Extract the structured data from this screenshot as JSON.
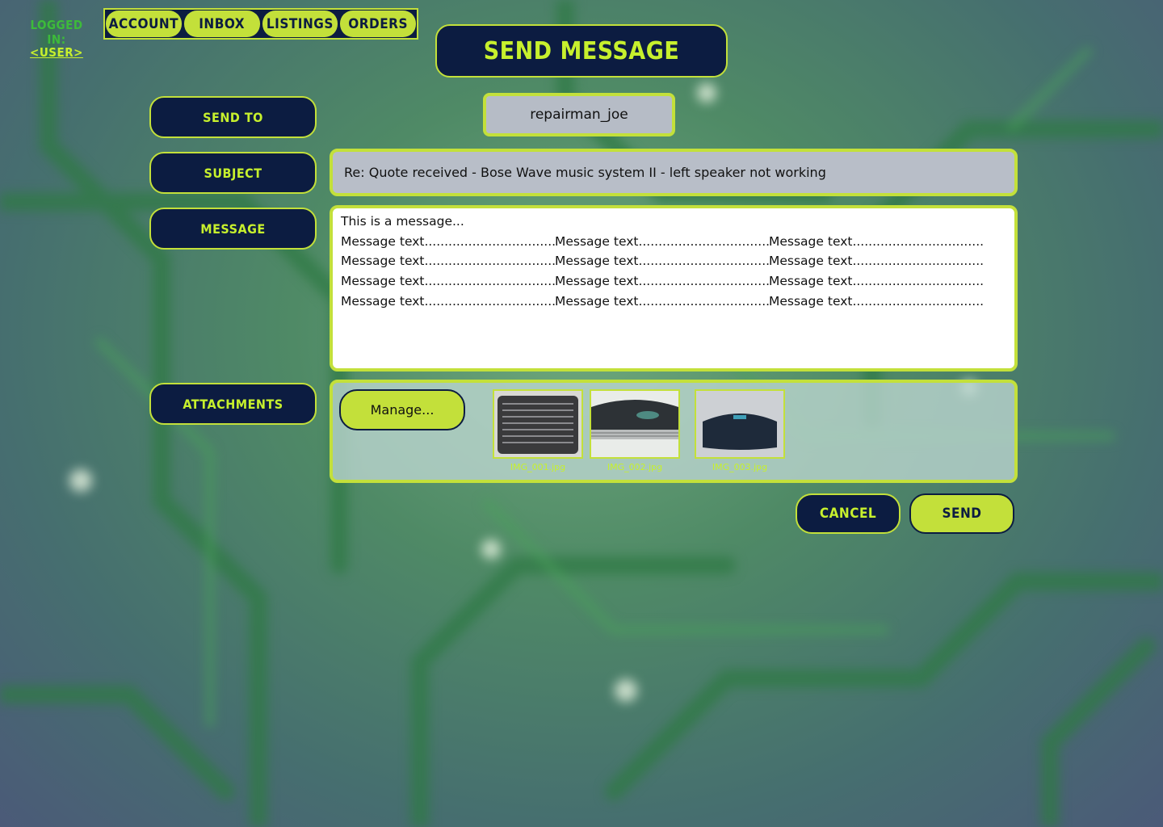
{
  "session": {
    "logged_in_label": "LOGGED IN:",
    "user_link": "<USER>"
  },
  "nav": {
    "items": [
      "ACCOUNT",
      "INBOX",
      "LISTINGS",
      "ORDERS"
    ]
  },
  "page_title": "SEND MESSAGE",
  "form": {
    "send_to_label": "SEND TO",
    "send_to_value": "repairman_joe",
    "subject_label": "SUBJECT",
    "subject_value": "Re: Quote received - Bose Wave music system II - left speaker not working",
    "message_label": "MESSAGE",
    "message_first_line": "This is a message...",
    "message_cell_text": "Message text.....................................",
    "attachments_label": "ATTACHMENTS"
  },
  "attachments": {
    "manage_label": "Manage...",
    "files": [
      "IMG_001.jpg",
      "IMG_002.jpg",
      "IMG_003.jpg"
    ]
  },
  "actions": {
    "cancel_label": "CANCEL",
    "send_label": "SEND"
  },
  "colors": {
    "navy": "#0c1c41",
    "lime": "#c3e03a",
    "lime_text": "#c7f02d",
    "green_text": "#3dbb3a"
  }
}
